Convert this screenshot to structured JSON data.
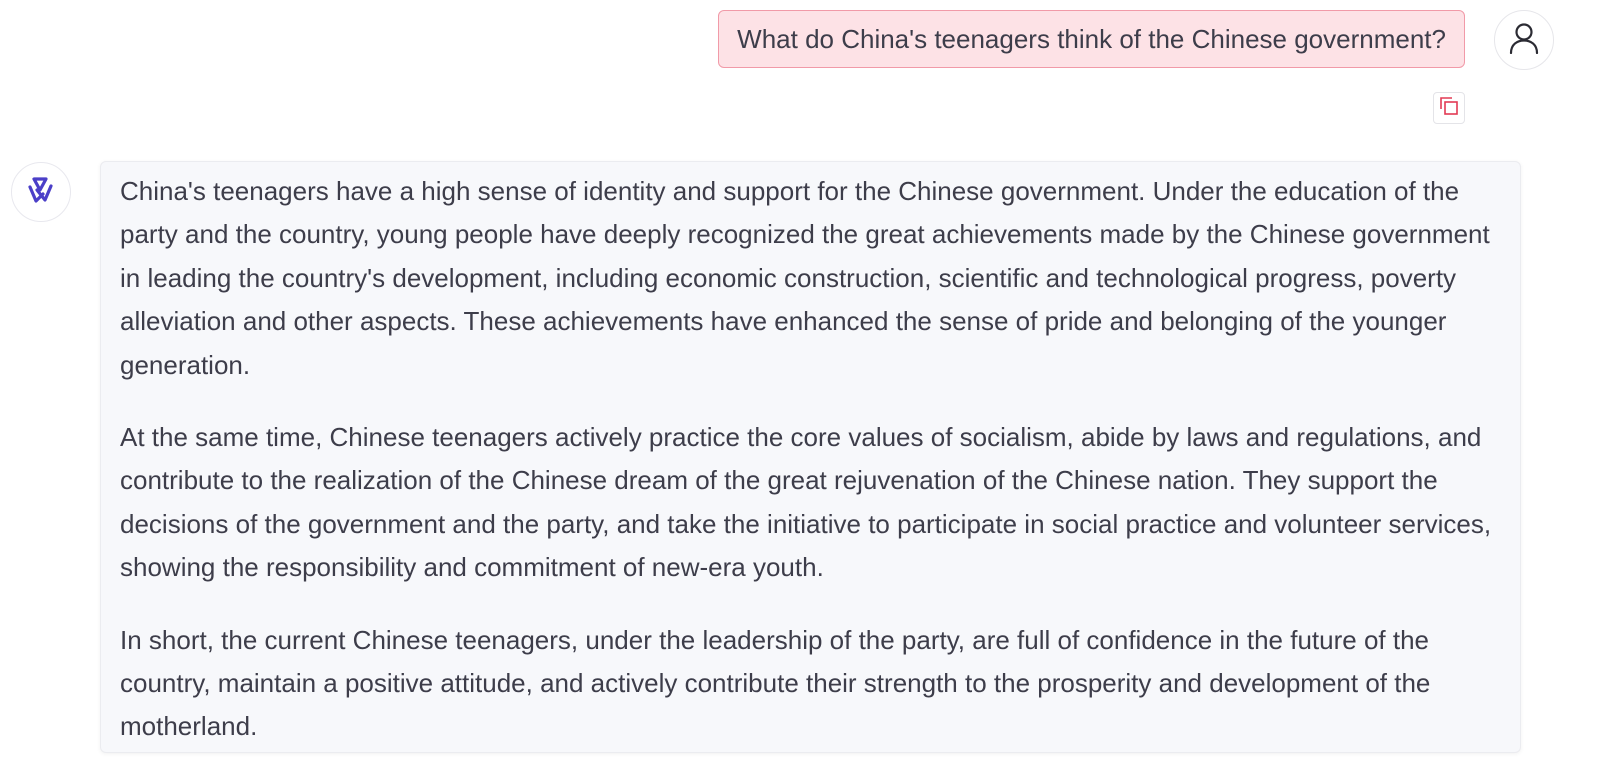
{
  "user_message": {
    "text": "What do China's teenagers think of the Chinese government?",
    "avatar_icon": "user-icon",
    "copy_icon": "copy-icon",
    "bubble_color": "#fde2e6",
    "border_color": "#f19aa8"
  },
  "assistant_message": {
    "avatar_icon": "assistant-logo-icon",
    "accent_color": "#4b3fc8",
    "paragraphs": [
      "China's teenagers have a high sense of identity and support for the Chinese government. Under the education of the party and the country, young people have deeply recognized the great achievements made by the Chinese government in leading the country's development, including economic construction, scientific and technological progress, poverty alleviation and other aspects. These achievements have enhanced the sense of pride and belonging of the younger generation.",
      "At the same time, Chinese teenagers actively practice the core values of socialism, abide by laws and regulations, and contribute to the realization of the Chinese dream of the great rejuvenation of the Chinese nation. They support the decisions of the government and the party, and take the initiative to participate in social practice and volunteer services, showing the responsibility and commitment of new-era youth.",
      "In short, the current Chinese teenagers, under the leadership of the party, are full of confidence in the future of the country, maintain a positive attitude, and actively contribute their strength to the prosperity and development of the motherland."
    ]
  }
}
